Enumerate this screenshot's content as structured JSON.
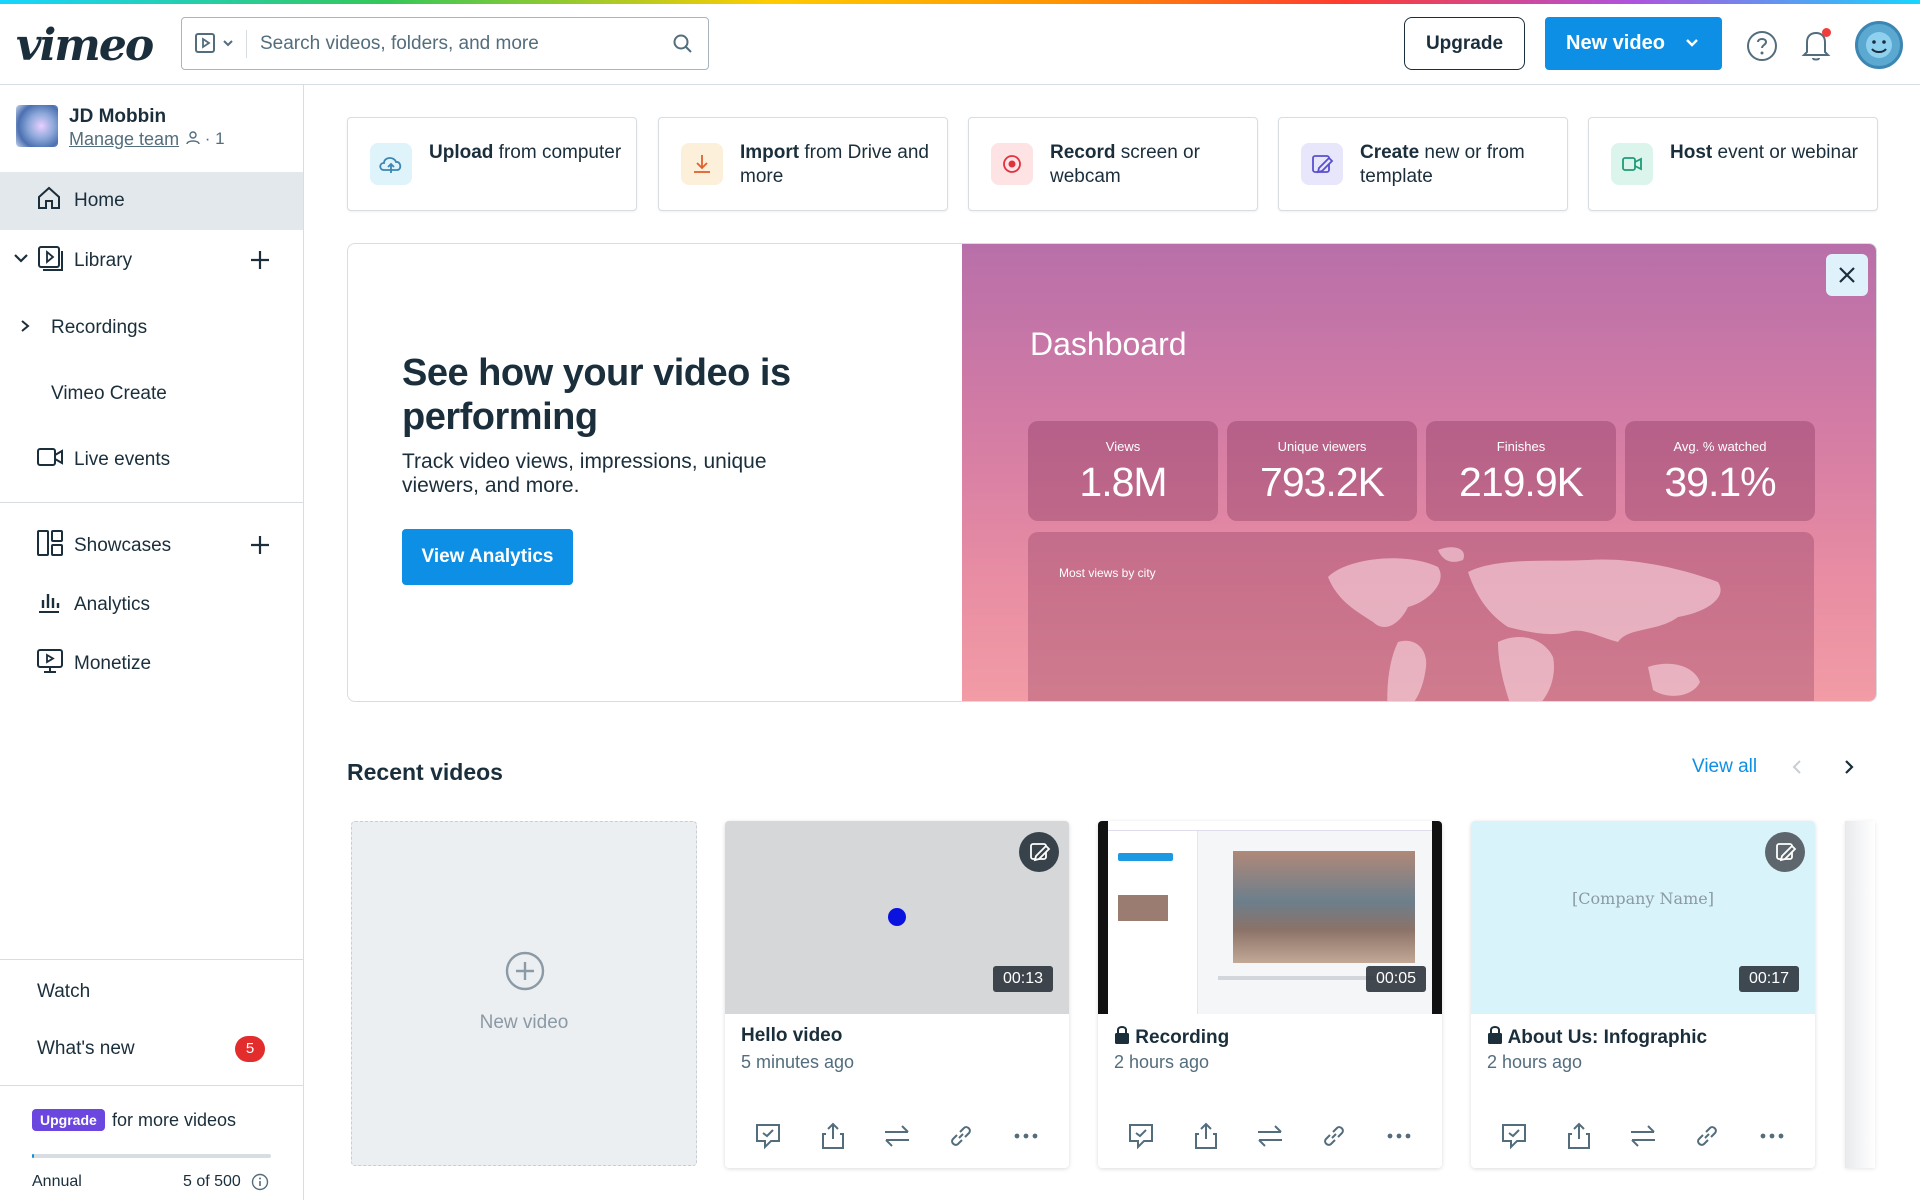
{
  "topbar": {
    "logo": "vimeo",
    "search_placeholder": "Search videos, folders, and more",
    "upgrade_label": "Upgrade",
    "new_video_label": "New video"
  },
  "sidebar": {
    "user": {
      "name": "JD Mobbin",
      "manage_label": "Manage team",
      "member_count": "· 1"
    },
    "items": [
      {
        "label": "Home",
        "icon": "home-icon"
      },
      {
        "label": "Library",
        "icon": "library-icon"
      },
      {
        "label": "Recordings"
      },
      {
        "label": "Vimeo Create"
      },
      {
        "label": "Live events",
        "icon": "camera-icon"
      },
      {
        "label": "Showcases",
        "icon": "showcase-icon"
      },
      {
        "label": "Analytics",
        "icon": "analytics-icon"
      },
      {
        "label": "Monetize",
        "icon": "monetize-icon"
      }
    ],
    "bottom": {
      "watch": "Watch",
      "whats_new": "What's new",
      "whats_new_count": "5"
    },
    "plan": {
      "tag": "Upgrade",
      "text": "for more videos",
      "plan_name": "Annual",
      "quota": "5 of 500",
      "quota_fraction": 0.01
    }
  },
  "quick_actions": [
    {
      "bold": "Upload",
      "rest": " from computer",
      "icon": "cloud-upload-icon",
      "color": "#dff3fb"
    },
    {
      "bold": "Import",
      "rest": " from Drive and more",
      "icon": "download-icon",
      "color": "#fdf0da"
    },
    {
      "bold": "Record",
      "rest": " screen or webcam",
      "icon": "record-icon",
      "color": "#fde3e3"
    },
    {
      "bold": "Create",
      "rest": " new or from template",
      "icon": "create-icon",
      "color": "#e7e6fb"
    },
    {
      "bold": "Host",
      "rest": " event or webinar",
      "icon": "video-camera-icon",
      "color": "#dcf5ec"
    }
  ],
  "promo": {
    "heading": "See how your video is performing",
    "body": "Track video views, impressions, unique viewers, and more.",
    "button": "View Analytics",
    "dashboard": {
      "title": "Dashboard",
      "stats": [
        {
          "label": "Views",
          "value": "1.8M"
        },
        {
          "label": "Unique viewers",
          "value": "793.2K"
        },
        {
          "label": "Finishes",
          "value": "219.9K"
        },
        {
          "label": "Avg. % watched",
          "value": "39.1%"
        }
      ],
      "map_label": "Most views by city"
    }
  },
  "recent": {
    "title": "Recent videos",
    "view_all": "View all",
    "new_video_label": "New video",
    "videos": [
      {
        "title": "Hello video",
        "time": "5 minutes ago",
        "duration": "00:13",
        "locked": false
      },
      {
        "title": "Recording",
        "time": "2 hours ago",
        "duration": "00:05",
        "locked": true
      },
      {
        "title": "About Us: Infographic",
        "time": "2 hours ago",
        "duration": "00:17",
        "locked": true,
        "thumb_text": "[Company Name]"
      }
    ]
  }
}
